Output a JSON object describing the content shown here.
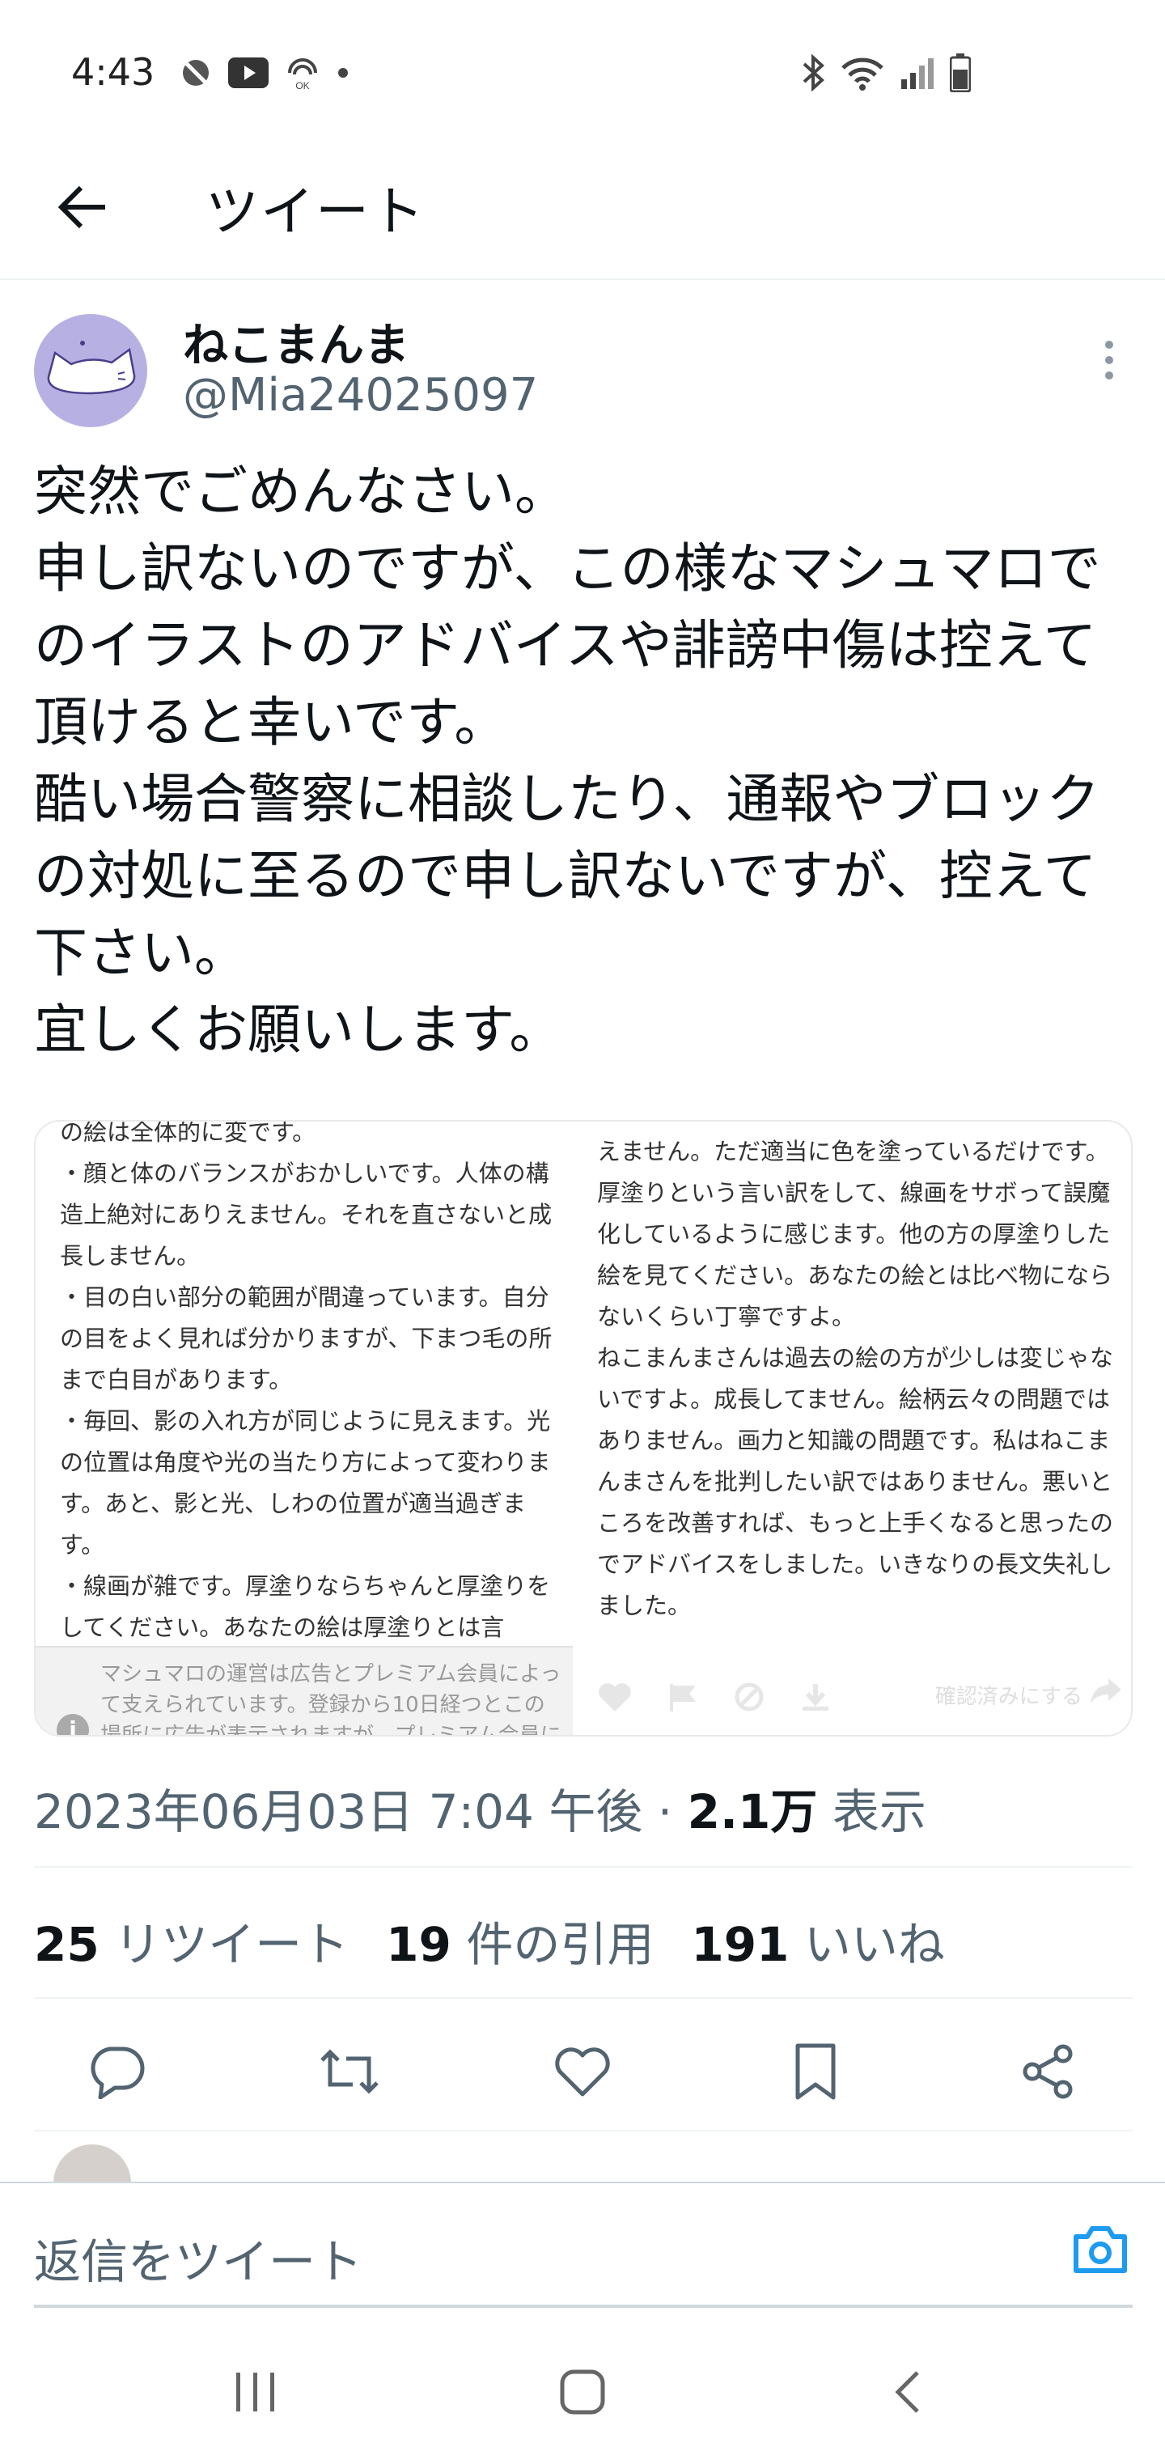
{
  "status_bar": {
    "time": "4:43",
    "left_icons": [
      "no-disturb-icon",
      "youtube-icon",
      "ok-google-icon",
      "dot-icon"
    ],
    "right_icons": [
      "bluetooth-icon",
      "wifi-icon",
      "signal-icon",
      "battery-icon"
    ]
  },
  "header": {
    "title": "ツイート"
  },
  "tweet": {
    "display_name": "ねこまんま",
    "handle": "@Mia24025097",
    "text": "突然でごめんなさい。\n申し訳ないのですが、この様なマシュマロでのイラストのアドバイスや誹謗中傷は控えて頂けると幸いです。\n酷い場合警察に相談したり、通報やブロックの対処に至るので申し訳ないですが、控えて下さい。\n宜しくお願いします。",
    "media": {
      "left_text": "の絵は全体的に変です。\n・顔と体のバランスがおかしいです。人体の構造上絶対にありえません。それを直さないと成長しません。\n・目の白い部分の範囲が間違っています。自分の目をよく見れば分かりますが、下まつ毛の所まで白目があります。\n・毎回、影の入れ方が同じように見えます。光の位置は角度や光の当たり方によって変わります。あと、影と光、しわの位置が適当過ぎます。\n・線画が雑です。厚塗りならちゃんと厚塗りをしてください。あなたの絵は厚塗りとは言",
      "left_footer": "マシュマロの運営は広告とプレミアム会員によって支えられています。登録から10日経つとこの場所に広告が表示されますが、プレミアム会員にな",
      "right_text": "えません。ただ適当に色を塗っているだけです。厚塗りという言い訳をして、線画をサボって誤魔化しているように感じます。他の方の厚塗りした絵を見てください。あなたの絵とは比べ物にならないくらい丁寧ですよ。\nねこまんまさんは過去の絵の方が少しは変じゃないですよ。成長してません。絵柄云々の問題ではありません。画力と知識の問題です。私はねこまんまさんを批判したい訳ではありません。悪いところを改善すれば、もっと上手くなると思ったのでアドバイスをしました。いきなりの長文失礼しました。",
      "right_confirm_label": "確認済みにする"
    },
    "timestamp": "2023年06月03日 7:04 午後",
    "views_count": "2.1万",
    "views_label": "表示",
    "retweets_count": "25",
    "retweets_label": "リツイート",
    "quotes_count": "19",
    "quotes_label": "件の引用",
    "likes_count": "191",
    "likes_label": "いいね"
  },
  "reply": {
    "placeholder": "返信をツイート"
  },
  "colors": {
    "accent": "#1d9bf0",
    "text": "#0f1419",
    "secondary": "#536471",
    "divider": "#eff3f4",
    "avatar": "#b7b0e3"
  }
}
